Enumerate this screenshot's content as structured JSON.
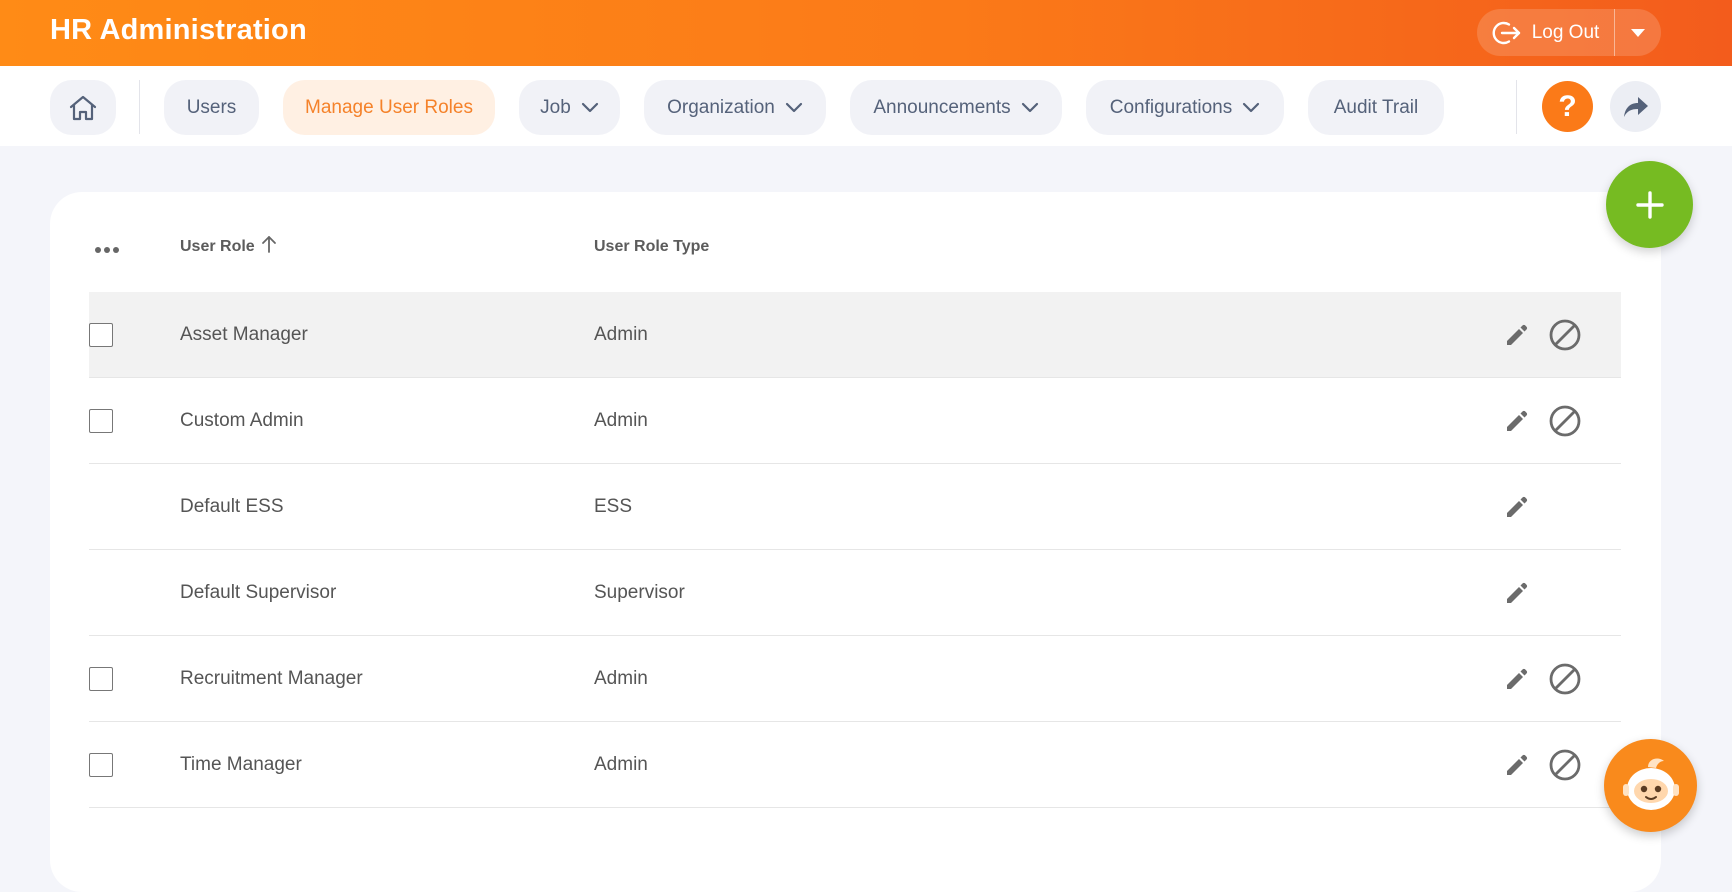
{
  "header": {
    "title": "HR Administration",
    "logout_label": "Log Out"
  },
  "nav": {
    "home_icon": "home-icon",
    "items": [
      {
        "label": "Users",
        "active": false,
        "dropdown": false
      },
      {
        "label": "Manage User Roles",
        "active": true,
        "dropdown": false
      },
      {
        "label": "Job",
        "active": false,
        "dropdown": true
      },
      {
        "label": "Organization",
        "active": false,
        "dropdown": true
      },
      {
        "label": "Announcements",
        "active": false,
        "dropdown": true
      },
      {
        "label": "Configurations",
        "active": false,
        "dropdown": true
      },
      {
        "label": "Audit Trail",
        "active": false,
        "dropdown": false
      }
    ],
    "help_label": "?"
  },
  "table": {
    "columns": {
      "role": "User Role",
      "type": "User Role Type"
    },
    "sort": "ascending",
    "rows": [
      {
        "role": "Asset Manager",
        "type": "Admin",
        "checkbox": true,
        "disable": true,
        "highlight": true
      },
      {
        "role": "Custom Admin",
        "type": "Admin",
        "checkbox": true,
        "disable": true,
        "highlight": false
      },
      {
        "role": "Default ESS",
        "type": "ESS",
        "checkbox": false,
        "disable": false,
        "highlight": false
      },
      {
        "role": "Default Supervisor",
        "type": "Supervisor",
        "checkbox": false,
        "disable": false,
        "highlight": false
      },
      {
        "role": "Recruitment Manager",
        "type": "Admin",
        "checkbox": true,
        "disable": true,
        "highlight": false
      },
      {
        "role": "Time Manager",
        "type": "Admin",
        "checkbox": true,
        "disable": true,
        "highlight": false
      }
    ]
  },
  "colors": {
    "accent": "#fb7a18",
    "add_button": "#76bb22"
  }
}
